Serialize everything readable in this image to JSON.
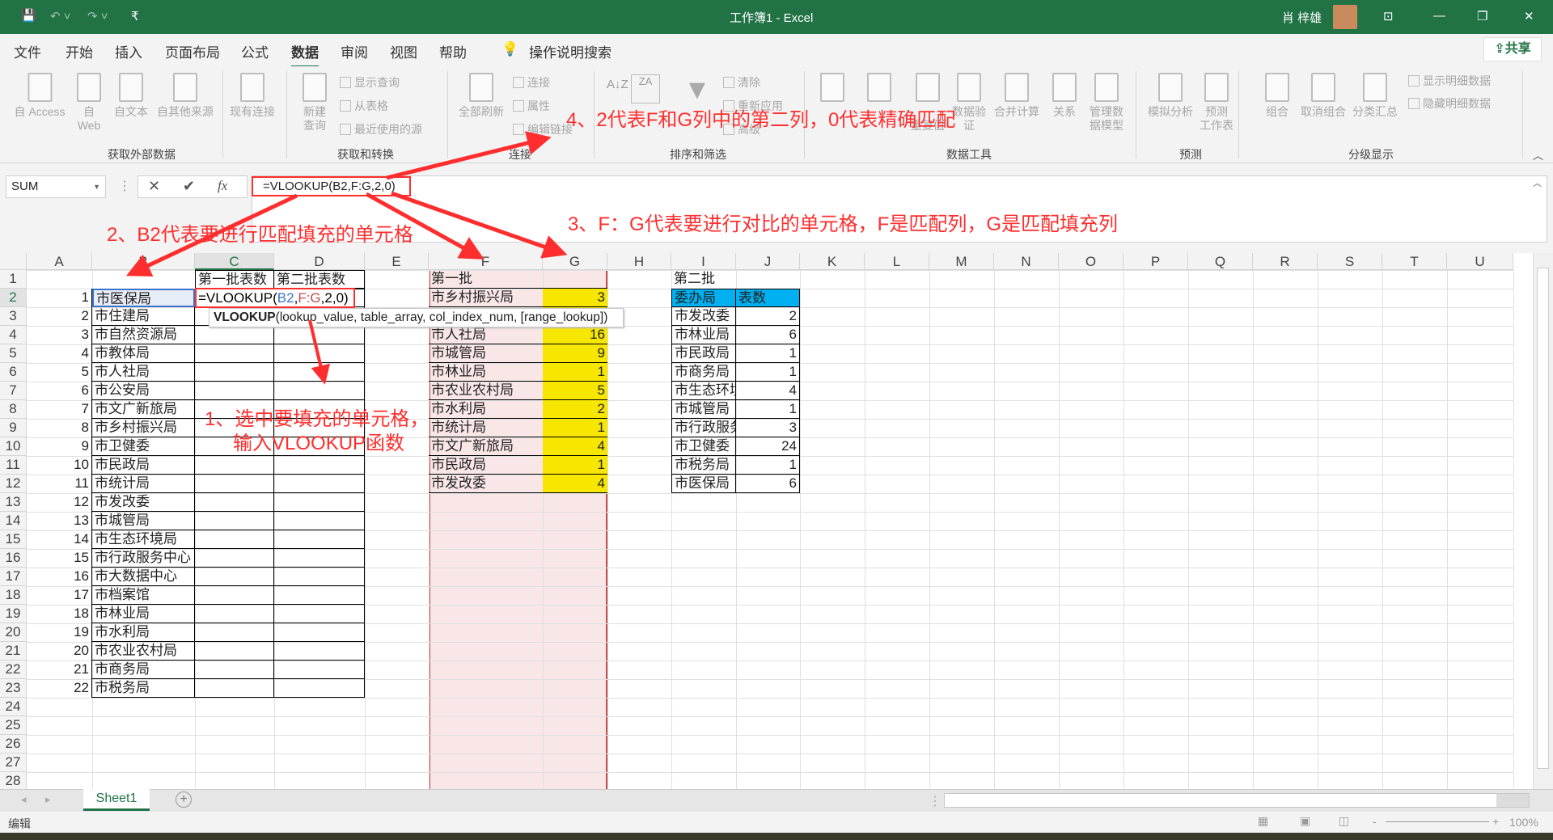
{
  "window": {
    "title": "工作簿1 - Excel",
    "user": "肖 梓雄"
  },
  "quick_access": {
    "icons": [
      "save-icon",
      "undo-icon",
      "redo-icon",
      "customize-icon"
    ]
  },
  "menu": {
    "tabs": [
      "文件",
      "开始",
      "插入",
      "页面布局",
      "公式",
      "数据",
      "审阅",
      "视图",
      "帮助"
    ],
    "active": "数据",
    "tell_me": "操作说明搜索",
    "share": "共享"
  },
  "ribbon": {
    "groups": [
      "获取外部数据",
      "获取和转换",
      "连接",
      "排序和筛选",
      "数据工具",
      "预测",
      "分级显示"
    ],
    "large": [
      "自 Access",
      "自\nWeb",
      "自文本",
      "自其他来源",
      "现有连接",
      "新建\n查询",
      "全部刷新",
      "数据验\n证",
      "合并计算",
      "关系",
      "管理数\n据模型",
      "重复值",
      "模拟分析",
      "预测\n工作表",
      "组合",
      "取消组合",
      "分类汇总"
    ],
    "small": [
      "显示查询",
      "从表格",
      "最近使用的源",
      "连接",
      "属性",
      "编辑链接",
      "清除",
      "重新应用",
      "高级",
      "显示明细数据",
      "隐藏明细数据"
    ]
  },
  "formula_bar": {
    "name_box": "SUM",
    "formula": "=VLOOKUP(B2,F:G,2,0)",
    "fx": "fx"
  },
  "sheet": {
    "columns": [
      "A",
      "B",
      "C",
      "D",
      "E",
      "F",
      "G",
      "H",
      "I",
      "J",
      "K",
      "L",
      "M",
      "N",
      "O",
      "P",
      "Q",
      "R",
      "S",
      "T",
      "U"
    ],
    "row_count": 28,
    "header_C1": "第一批表数",
    "header_D1": "第二批表数",
    "colA": [
      1,
      2,
      3,
      4,
      5,
      6,
      7,
      8,
      9,
      10,
      11,
      12,
      13,
      14,
      15,
      16,
      17,
      18,
      19,
      20,
      21,
      22
    ],
    "colB": [
      "市医保局",
      "市住建局",
      "市自然资源局",
      "市教体局",
      "市人社局",
      "市公安局",
      "市文广新旅局",
      "市乡村振兴局",
      "市卫健委",
      "市民政局",
      "市统计局",
      "市发改委",
      "市城管局",
      "市生态环境局",
      "市行政服务中心",
      "市大数据中心",
      "市档案馆",
      "市林业局",
      "市水利局",
      "市农业农村局",
      "市商务局",
      "市税务局"
    ],
    "C2_editing": {
      "prefix": "=VLOOKUP(",
      "ref1": "B2",
      ",": ",",
      "ref2": "F:G",
      "suffix": ",2,0)"
    },
    "F1": "第一批",
    "first_batch": [
      [
        "市乡村振兴局",
        3
      ],
      [
        "",
        ""
      ],
      [
        "市人社局",
        16
      ],
      [
        "市城管局",
        9
      ],
      [
        "市林业局",
        1
      ],
      [
        "市农业农村局",
        5
      ],
      [
        "市水利局",
        2
      ],
      [
        "市统计局",
        1
      ],
      [
        "市文广新旅局",
        4
      ],
      [
        "市民政局",
        1
      ],
      [
        "市发改委",
        4
      ]
    ],
    "I1": "第二批",
    "I2": "委办局",
    "J2": "表数",
    "second_batch": [
      [
        "市发改委",
        2
      ],
      [
        "市林业局",
        6
      ],
      [
        "市民政局",
        1
      ],
      [
        "市商务局",
        1
      ],
      [
        "市生态环境局",
        4
      ],
      [
        "市城管局",
        1
      ],
      [
        "市行政服务中心",
        3
      ],
      [
        "市卫健委",
        24
      ],
      [
        "市税务局",
        1
      ],
      [
        "市医保局",
        6
      ]
    ],
    "tooltip": {
      "fn": "VLOOKUP",
      "args": "(lookup_value, table_array, col_index_num, [range_lookup])"
    },
    "sheet_tab": "Sheet1"
  },
  "annotations": {
    "a1_line1": "1、选中要填充的单元格，",
    "a1_line2": "输入VLOOKUP函数",
    "a2": "2、B2代表要进行匹配填充的单元格",
    "a3": "3、F：G代表要进行对比的单元格，F是匹配列，G是匹配填充列",
    "a4": "4、2代表F和G列中的第二列，0代表精确匹配"
  },
  "status": {
    "mode": "编辑",
    "zoom": "100%"
  },
  "colors": {
    "excel_green": "#217346",
    "highlight_yellow": "#ffff00",
    "header_blue": "#00b0f0",
    "pink_fill": "#f9e6e6",
    "annotation_red": "#ff2e2e"
  }
}
